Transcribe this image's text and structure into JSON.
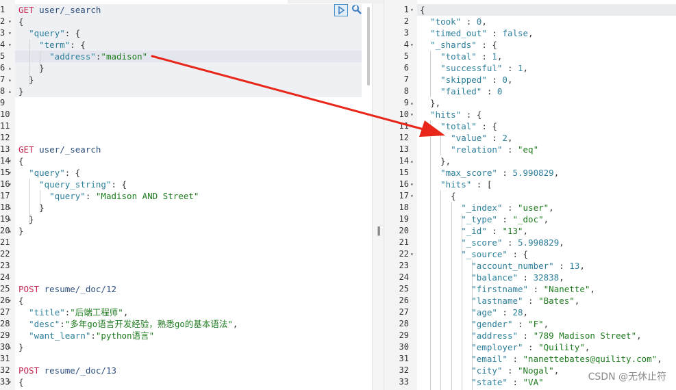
{
  "editor": {
    "request_lines": [
      {
        "n": "1",
        "f": "",
        "t": [
          [
            "m",
            "GET"
          ],
          [
            "u",
            " user/_search"
          ]
        ]
      },
      {
        "n": "2",
        "f": "▾",
        "t": [
          [
            "p",
            "{"
          ]
        ]
      },
      {
        "n": "3",
        "f": "▾",
        "t": [
          [
            "p",
            "  "
          ],
          [
            "k",
            "\"query\""
          ],
          [
            "p",
            ": {"
          ]
        ]
      },
      {
        "n": "4",
        "f": "▾",
        "t": [
          [
            "p",
            "    "
          ],
          [
            "k",
            "\"term\""
          ],
          [
            "p",
            ": {"
          ]
        ]
      },
      {
        "n": "5",
        "f": "",
        "t": [
          [
            "p",
            "      "
          ],
          [
            "k",
            "\"address\""
          ],
          [
            "p",
            ":"
          ],
          [
            "s",
            "\"madison\""
          ]
        ]
      },
      {
        "n": "6",
        "f": "▴",
        "t": [
          [
            "p",
            "    }"
          ]
        ]
      },
      {
        "n": "7",
        "f": "▴",
        "t": [
          [
            "p",
            "  }"
          ]
        ]
      },
      {
        "n": "8",
        "f": "▴",
        "t": [
          [
            "p",
            "}"
          ]
        ]
      },
      {
        "n": "9",
        "f": "",
        "t": []
      },
      {
        "n": "10",
        "f": "",
        "t": []
      },
      {
        "n": "11",
        "f": "",
        "t": []
      },
      {
        "n": "12",
        "f": "",
        "t": []
      },
      {
        "n": "13",
        "f": "",
        "t": [
          [
            "m",
            "GET"
          ],
          [
            "u",
            " user/_search"
          ]
        ]
      },
      {
        "n": "14",
        "f": "▾",
        "t": [
          [
            "p",
            "{"
          ]
        ]
      },
      {
        "n": "15",
        "f": "▾",
        "t": [
          [
            "p",
            "  "
          ],
          [
            "k",
            "\"query\""
          ],
          [
            "p",
            ": {"
          ]
        ]
      },
      {
        "n": "16",
        "f": "▾",
        "t": [
          [
            "p",
            "    "
          ],
          [
            "k",
            "\"query_string\""
          ],
          [
            "p",
            ": {"
          ]
        ]
      },
      {
        "n": "17",
        "f": "",
        "t": [
          [
            "p",
            "      "
          ],
          [
            "k",
            "\"query\""
          ],
          [
            "p",
            ": "
          ],
          [
            "s",
            "\"Madison AND Street\""
          ]
        ]
      },
      {
        "n": "18",
        "f": "▴",
        "t": [
          [
            "p",
            "    }"
          ]
        ]
      },
      {
        "n": "19",
        "f": "▴",
        "t": [
          [
            "p",
            "  }"
          ]
        ]
      },
      {
        "n": "20",
        "f": "▴",
        "t": [
          [
            "p",
            "}"
          ]
        ]
      },
      {
        "n": "21",
        "f": "",
        "t": []
      },
      {
        "n": "22",
        "f": "",
        "t": []
      },
      {
        "n": "23",
        "f": "",
        "t": []
      },
      {
        "n": "24",
        "f": "",
        "t": []
      },
      {
        "n": "25",
        "f": "",
        "t": [
          [
            "m",
            "POST"
          ],
          [
            "u",
            " resume/_doc/12"
          ]
        ]
      },
      {
        "n": "26",
        "f": "▾",
        "t": [
          [
            "p",
            "{"
          ]
        ]
      },
      {
        "n": "27",
        "f": "",
        "t": [
          [
            "p",
            "  "
          ],
          [
            "k",
            "\"title\""
          ],
          [
            "p",
            ":"
          ],
          [
            "s",
            "\"后端工程师\""
          ],
          [
            "p",
            ","
          ]
        ]
      },
      {
        "n": "28",
        "f": "",
        "t": [
          [
            "p",
            "  "
          ],
          [
            "k",
            "\"desc\""
          ],
          [
            "p",
            ":"
          ],
          [
            "s",
            "\"多年go语言开发经验，熟悉go的基本语法\""
          ],
          [
            "p",
            ","
          ]
        ]
      },
      {
        "n": "29",
        "f": "",
        "t": [
          [
            "p",
            "  "
          ],
          [
            "k",
            "\"want_learn\""
          ],
          [
            "p",
            ":"
          ],
          [
            "s",
            "\"python语言\""
          ]
        ]
      },
      {
        "n": "30",
        "f": "▴",
        "t": [
          [
            "p",
            "}"
          ]
        ]
      },
      {
        "n": "31",
        "f": "",
        "t": []
      },
      {
        "n": "32",
        "f": "",
        "t": [
          [
            "m",
            "POST"
          ],
          [
            "u",
            " resume/_doc/13"
          ]
        ]
      },
      {
        "n": "33",
        "f": "▾",
        "t": [
          [
            "p",
            "{"
          ]
        ]
      }
    ],
    "response_lines": [
      {
        "n": "1",
        "f": "▾",
        "t": [
          [
            "p",
            "{"
          ]
        ]
      },
      {
        "n": "2",
        "f": "",
        "t": [
          [
            "p",
            "  "
          ],
          [
            "k",
            "\"took\""
          ],
          [
            "p",
            " : "
          ],
          [
            "v",
            "0"
          ],
          [
            "p",
            ","
          ]
        ]
      },
      {
        "n": "3",
        "f": "",
        "t": [
          [
            "p",
            "  "
          ],
          [
            "k",
            "\"timed_out\""
          ],
          [
            "p",
            " : "
          ],
          [
            "v",
            "false"
          ],
          [
            "p",
            ","
          ]
        ]
      },
      {
        "n": "4",
        "f": "▾",
        "t": [
          [
            "p",
            "  "
          ],
          [
            "k",
            "\"_shards\""
          ],
          [
            "p",
            " : {"
          ]
        ]
      },
      {
        "n": "5",
        "f": "",
        "t": [
          [
            "p",
            "    "
          ],
          [
            "k",
            "\"total\""
          ],
          [
            "p",
            " : "
          ],
          [
            "v",
            "1"
          ],
          [
            "p",
            ","
          ]
        ]
      },
      {
        "n": "6",
        "f": "",
        "t": [
          [
            "p",
            "    "
          ],
          [
            "k",
            "\"successful\""
          ],
          [
            "p",
            " : "
          ],
          [
            "v",
            "1"
          ],
          [
            "p",
            ","
          ]
        ]
      },
      {
        "n": "7",
        "f": "",
        "t": [
          [
            "p",
            "    "
          ],
          [
            "k",
            "\"skipped\""
          ],
          [
            "p",
            " : "
          ],
          [
            "v",
            "0"
          ],
          [
            "p",
            ","
          ]
        ]
      },
      {
        "n": "8",
        "f": "",
        "t": [
          [
            "p",
            "    "
          ],
          [
            "k",
            "\"failed\""
          ],
          [
            "p",
            " : "
          ],
          [
            "v",
            "0"
          ]
        ]
      },
      {
        "n": "9",
        "f": "▴",
        "t": [
          [
            "p",
            "  },"
          ]
        ]
      },
      {
        "n": "10",
        "f": "▾",
        "t": [
          [
            "p",
            "  "
          ],
          [
            "k",
            "\"hits\""
          ],
          [
            "p",
            " : {"
          ]
        ]
      },
      {
        "n": "11",
        "f": "▾",
        "t": [
          [
            "p",
            "    "
          ],
          [
            "k",
            "\"total\""
          ],
          [
            "p",
            " : {"
          ]
        ]
      },
      {
        "n": "12",
        "f": "",
        "t": [
          [
            "p",
            "      "
          ],
          [
            "k",
            "\"value\""
          ],
          [
            "p",
            " : "
          ],
          [
            "v",
            "2"
          ],
          [
            "p",
            ","
          ]
        ]
      },
      {
        "n": "13",
        "f": "",
        "t": [
          [
            "p",
            "      "
          ],
          [
            "k",
            "\"relation\""
          ],
          [
            "p",
            " : "
          ],
          [
            "s",
            "\"eq\""
          ]
        ]
      },
      {
        "n": "14",
        "f": "▴",
        "t": [
          [
            "p",
            "    },"
          ]
        ]
      },
      {
        "n": "15",
        "f": "",
        "t": [
          [
            "p",
            "    "
          ],
          [
            "k",
            "\"max_score\""
          ],
          [
            "p",
            " : "
          ],
          [
            "v",
            "5.990829"
          ],
          [
            "p",
            ","
          ]
        ]
      },
      {
        "n": "16",
        "f": "▾",
        "t": [
          [
            "p",
            "    "
          ],
          [
            "k",
            "\"hits\""
          ],
          [
            "p",
            " : ["
          ]
        ]
      },
      {
        "n": "17",
        "f": "▾",
        "t": [
          [
            "p",
            "      {"
          ]
        ]
      },
      {
        "n": "18",
        "f": "",
        "t": [
          [
            "p",
            "        "
          ],
          [
            "k",
            "\"_index\""
          ],
          [
            "p",
            " : "
          ],
          [
            "s",
            "\"user\""
          ],
          [
            "p",
            ","
          ]
        ]
      },
      {
        "n": "19",
        "f": "",
        "t": [
          [
            "p",
            "        "
          ],
          [
            "k",
            "\"_type\""
          ],
          [
            "p",
            " : "
          ],
          [
            "s",
            "\"_doc\""
          ],
          [
            "p",
            ","
          ]
        ]
      },
      {
        "n": "20",
        "f": "",
        "t": [
          [
            "p",
            "        "
          ],
          [
            "k",
            "\"_id\""
          ],
          [
            "p",
            " : "
          ],
          [
            "s",
            "\"13\""
          ],
          [
            "p",
            ","
          ]
        ]
      },
      {
        "n": "21",
        "f": "",
        "t": [
          [
            "p",
            "        "
          ],
          [
            "k",
            "\"_score\""
          ],
          [
            "p",
            " : "
          ],
          [
            "v",
            "5.990829"
          ],
          [
            "p",
            ","
          ]
        ]
      },
      {
        "n": "22",
        "f": "▾",
        "t": [
          [
            "p",
            "        "
          ],
          [
            "k",
            "\"_source\""
          ],
          [
            "p",
            " : {"
          ]
        ]
      },
      {
        "n": "23",
        "f": "",
        "t": [
          [
            "p",
            "          "
          ],
          [
            "k",
            "\"account_number\""
          ],
          [
            "p",
            " : "
          ],
          [
            "v",
            "13"
          ],
          [
            "p",
            ","
          ]
        ]
      },
      {
        "n": "24",
        "f": "",
        "t": [
          [
            "p",
            "          "
          ],
          [
            "k",
            "\"balance\""
          ],
          [
            "p",
            " : "
          ],
          [
            "v",
            "32838"
          ],
          [
            "p",
            ","
          ]
        ]
      },
      {
        "n": "25",
        "f": "",
        "t": [
          [
            "p",
            "          "
          ],
          [
            "k",
            "\"firstname\""
          ],
          [
            "p",
            " : "
          ],
          [
            "s",
            "\"Nanette\""
          ],
          [
            "p",
            ","
          ]
        ]
      },
      {
        "n": "26",
        "f": "",
        "t": [
          [
            "p",
            "          "
          ],
          [
            "k",
            "\"lastname\""
          ],
          [
            "p",
            " : "
          ],
          [
            "s",
            "\"Bates\""
          ],
          [
            "p",
            ","
          ]
        ]
      },
      {
        "n": "27",
        "f": "",
        "t": [
          [
            "p",
            "          "
          ],
          [
            "k",
            "\"age\""
          ],
          [
            "p",
            " : "
          ],
          [
            "v",
            "28"
          ],
          [
            "p",
            ","
          ]
        ]
      },
      {
        "n": "28",
        "f": "",
        "t": [
          [
            "p",
            "          "
          ],
          [
            "k",
            "\"gender\""
          ],
          [
            "p",
            " : "
          ],
          [
            "s",
            "\"F\""
          ],
          [
            "p",
            ","
          ]
        ]
      },
      {
        "n": "29",
        "f": "",
        "t": [
          [
            "p",
            "          "
          ],
          [
            "k",
            "\"address\""
          ],
          [
            "p",
            " : "
          ],
          [
            "s",
            "\"789 Madison Street\""
          ],
          [
            "p",
            ","
          ]
        ]
      },
      {
        "n": "30",
        "f": "",
        "t": [
          [
            "p",
            "          "
          ],
          [
            "k",
            "\"employer\""
          ],
          [
            "p",
            " : "
          ],
          [
            "s",
            "\"Quility\""
          ],
          [
            "p",
            ","
          ]
        ]
      },
      {
        "n": "31",
        "f": "",
        "t": [
          [
            "p",
            "          "
          ],
          [
            "k",
            "\"email\""
          ],
          [
            "p",
            " : "
          ],
          [
            "s",
            "\"nanettebates@quility.com\""
          ],
          [
            "p",
            ","
          ]
        ]
      },
      {
        "n": "32",
        "f": "",
        "t": [
          [
            "p",
            "          "
          ],
          [
            "k",
            "\"city\""
          ],
          [
            "p",
            " : "
          ],
          [
            "s",
            "\"Nogal\""
          ],
          [
            "p",
            ","
          ]
        ]
      },
      {
        "n": "33",
        "f": "",
        "t": [
          [
            "p",
            "          "
          ],
          [
            "k",
            "\"state\""
          ],
          [
            "p",
            " : "
          ],
          [
            "s",
            "\"VA\""
          ]
        ]
      }
    ]
  },
  "watermark": "CSDN @无休止符",
  "icons": {
    "run": "play-icon",
    "settings": "wrench-icon",
    "resize": "resize-grip-icon"
  },
  "colors": {
    "method": "#c7254e",
    "key": "#2d7f9b",
    "string": "#1e7b1e",
    "annotation_arrow": "#e8271a"
  }
}
